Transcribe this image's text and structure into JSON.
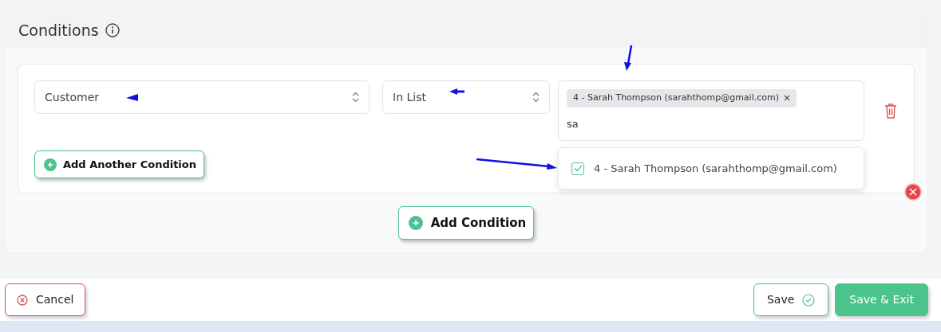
{
  "section": {
    "title": "Conditions"
  },
  "conditions": [
    {
      "field": "Customer",
      "operator": "In List",
      "tags": [
        {
          "label": "4 - Sarah Thompson (sarahthomp@gmail.com)"
        }
      ],
      "search_value": "sa",
      "options": [
        {
          "label": "4 - Sarah Thompson (sarahthomp@gmail.com)",
          "checked": true
        }
      ]
    }
  ],
  "add_another_label": "Add Another Condition",
  "add_condition_label": "Add Condition",
  "footer": {
    "cancel": "Cancel",
    "save": "Save",
    "save_exit": "Save & Exit"
  }
}
